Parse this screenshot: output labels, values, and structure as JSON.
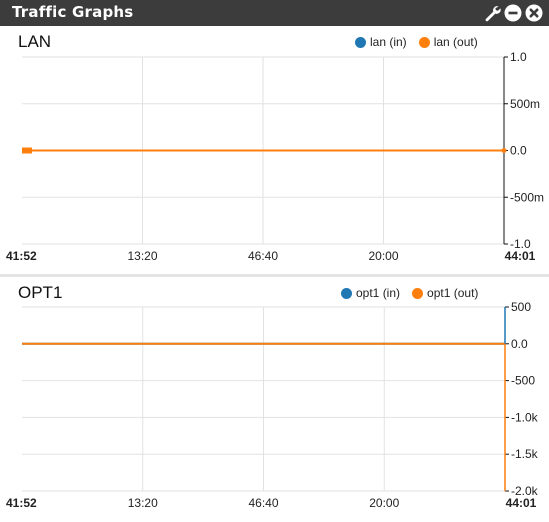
{
  "widget": {
    "title": "Traffic Graphs",
    "icons": [
      "wrench-icon",
      "minimize-icon",
      "close-icon"
    ]
  },
  "colors": {
    "in": "#1f77b4",
    "out": "#ff7f0e"
  },
  "chart_data": [
    {
      "type": "line",
      "title": "LAN",
      "x_ticks": [
        "41:52",
        "13:20",
        "46:40",
        "20:00",
        "44:01"
      ],
      "y_ticks": [
        "1.0",
        "500m",
        "0.0",
        "-500m",
        "-1.0"
      ],
      "ylim": [
        -1,
        1
      ],
      "y_axis_side": "right",
      "grid": true,
      "legend_position": "top-right",
      "series": [
        {
          "name": "lan (in)",
          "key": "in",
          "values": [
            0,
            0
          ]
        },
        {
          "name": "lan (out)",
          "key": "out",
          "values": [
            0,
            0
          ]
        }
      ]
    },
    {
      "type": "line",
      "title": "OPT1",
      "x_ticks": [
        "41:52",
        "13:20",
        "46:40",
        "20:00",
        "44:01"
      ],
      "y_ticks": [
        "500",
        "0.0",
        "-500",
        "-1.0k",
        "-1.5k",
        "-2.0k"
      ],
      "ylim": [
        -2000,
        500
      ],
      "y_axis_side": "right",
      "grid": true,
      "legend_position": "top-right",
      "series": [
        {
          "name": "opt1 (in)",
          "key": "in",
          "values": [
            0,
            0
          ]
        },
        {
          "name": "opt1 (out)",
          "key": "out",
          "values": [
            0,
            0
          ]
        }
      ]
    }
  ]
}
